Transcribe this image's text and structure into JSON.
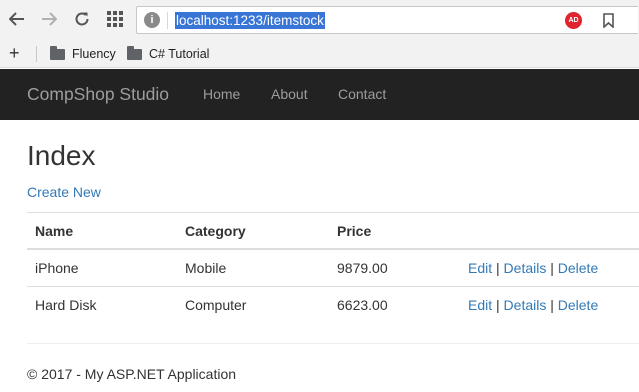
{
  "browser": {
    "url": "localhost:1233/itemstock",
    "site_info_icon": "info-icon",
    "extension_badge": "AD",
    "bookmarks": [
      {
        "label": "Fluency"
      },
      {
        "label": "C# Tutorial"
      }
    ],
    "add_label": "+"
  },
  "navbar": {
    "brand": "CompShop Studio",
    "links": [
      {
        "label": "Home"
      },
      {
        "label": "About"
      },
      {
        "label": "Contact"
      }
    ]
  },
  "page": {
    "title": "Index",
    "create_link": "Create New"
  },
  "table": {
    "headers": [
      "Name",
      "Category",
      "Price"
    ],
    "rows": [
      {
        "name": "iPhone",
        "category": "Mobile",
        "price": "9879.00"
      },
      {
        "name": "Hard Disk",
        "category": "Computer",
        "price": "6623.00"
      }
    ],
    "actions": {
      "edit": "Edit",
      "details": "Details",
      "delete": "Delete",
      "separator": "|"
    }
  },
  "footer": {
    "text": "© 2017 - My ASP.NET Application"
  },
  "colors": {
    "navbar_bg": "#222222",
    "link": "#337ab7",
    "url_highlight": "#3875d7"
  }
}
